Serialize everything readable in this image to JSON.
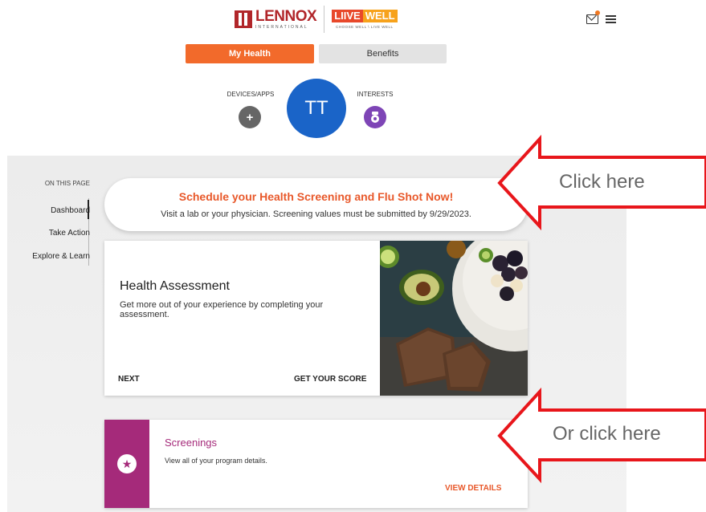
{
  "header": {
    "brand_primary": "LENNOX",
    "brand_primary_sub": "INTERNATIONAL",
    "brand_secondary_live": "LIIVE",
    "brand_secondary_well": "WELL",
    "brand_secondary_tagline": "CHOOSE WELL \\ LIVE WELL",
    "mail_icon": "mail-icon",
    "menu_icon": "hamburger-menu-icon"
  },
  "tabs": [
    {
      "label": "My Health",
      "active": true
    },
    {
      "label": "Benefits",
      "active": false
    }
  ],
  "profile": {
    "devices_label": "DEVICES/APPS",
    "devices_action": "+",
    "avatar_initials": "TT",
    "interests_label": "INTERESTS"
  },
  "on_this_page": {
    "heading": "ON THIS PAGE",
    "items": [
      "Dashboard",
      "Take Action",
      "Explore & Learn"
    ],
    "active_index": 0
  },
  "schedule_banner": {
    "title": "Schedule your Health Screening and Flu Shot Now!",
    "subtitle": "Visit a lab or your physician. Screening values must be submitted by 9/29/2023."
  },
  "health_assessment": {
    "title": "Health Assessment",
    "description": "Get more out of your experience by completing your assessment.",
    "next_label": "NEXT",
    "score_label": "GET YOUR SCORE"
  },
  "screenings": {
    "title": "Screenings",
    "description": "View all of your program details.",
    "view_label": "VIEW DETAILS"
  },
  "annotations": {
    "callout_1": "Click here",
    "callout_2": "Or click here",
    "arrow_color": "#e8161b"
  },
  "colors": {
    "accent_orange": "#f26a2b",
    "avatar_blue": "#1a64c8",
    "interests_purple": "#7e45b6",
    "screenings_magenta": "#a52a7a",
    "lennox_red": "#b1262a"
  }
}
